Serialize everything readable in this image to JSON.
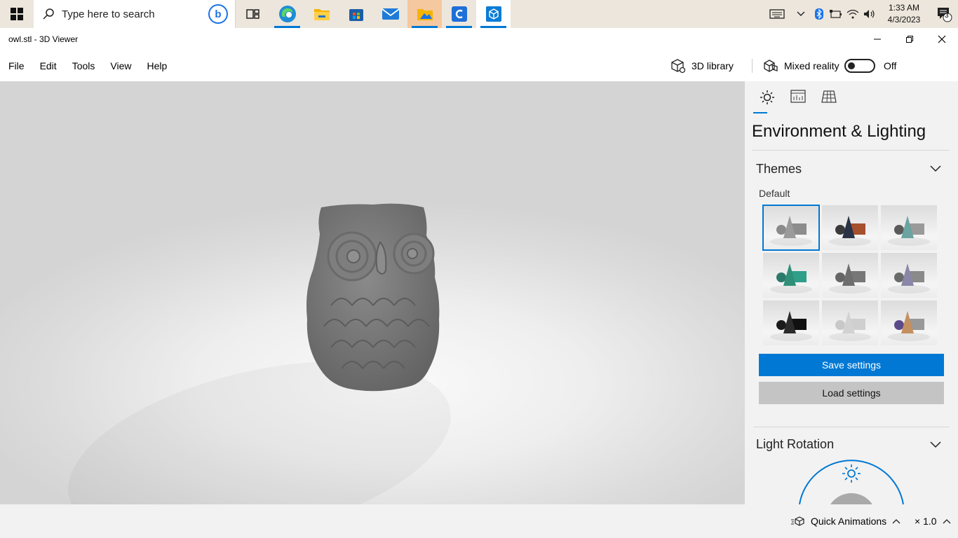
{
  "taskbar": {
    "search_placeholder": "Type here to search",
    "time": "1:33 AM",
    "date": "4/3/2023",
    "notification_count": "3",
    "apps": [
      "task-view",
      "edge",
      "file-explorer",
      "microsoft-store",
      "mail",
      "photos",
      "cortana-app",
      "3d-viewer"
    ]
  },
  "window": {
    "title": "owl.stl - 3D Viewer"
  },
  "menu": {
    "items": [
      "File",
      "Edit",
      "Tools",
      "View",
      "Help"
    ],
    "library": "3D library",
    "mixed_reality": "Mixed reality",
    "mixed_reality_state": "Off"
  },
  "panel": {
    "title": "Environment & Lighting",
    "themes_header": "Themes",
    "themes_label": "Default",
    "save": "Save settings",
    "load": "Load settings",
    "light_rotation_header": "Light Rotation"
  },
  "status": {
    "quick_animations": "Quick Animations",
    "speed": "× 1.0"
  },
  "colors": {
    "accent": "#0078d4",
    "taskbar": "#ede6dc",
    "viewport": "#e4e4e4",
    "model": "#7a7a7a"
  },
  "themes": [
    {
      "cone": "#9a9a9a",
      "box": "#8c8c8c",
      "sphere": "#8a8a8a"
    },
    {
      "cone": "#2a3346",
      "box": "#a6502e",
      "sphere": "#3a3a3a"
    },
    {
      "cone": "#6aa3a0",
      "box": "#9a9a9a",
      "sphere": "#5a5a5a"
    },
    {
      "cone": "#2f8f78",
      "box": "#2f9f8a",
      "sphere": "#2c7a6a"
    },
    {
      "cone": "#6e6e6e",
      "box": "#777777",
      "sphere": "#666666"
    },
    {
      "cone": "#8a86a8",
      "box": "#8a8a8a",
      "sphere": "#6a6a6a"
    },
    {
      "cone": "#2b2b2b",
      "box": "#111111",
      "sphere": "#1b1b1b"
    },
    {
      "cone": "#d2d2d2",
      "box": "#cfcfcf",
      "sphere": "#c8c8c8"
    },
    {
      "cone": "#c49060",
      "box": "#999999",
      "sphere": "#5b4a8a"
    }
  ]
}
